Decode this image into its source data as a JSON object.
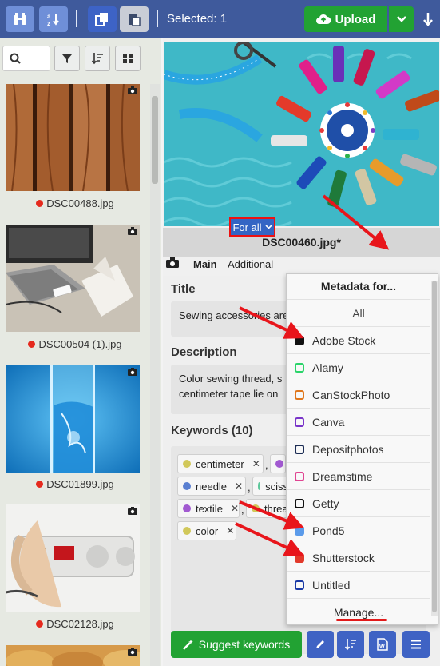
{
  "toolbar": {
    "selected_label": "Selected: 1",
    "upload_label": "Upload"
  },
  "left_panel": {
    "search_placeholder": "",
    "thumbnails": [
      {
        "file": "DSC00488.jpg",
        "status_color": "#e52a1e"
      },
      {
        "file": "DSC00504 (1).jpg",
        "status_color": "#e52a1e"
      },
      {
        "file": "DSC01899.jpg",
        "status_color": "#e52a1e"
      },
      {
        "file": "DSC02128.jpg",
        "status_color": "#e52a1e"
      }
    ]
  },
  "preview": {
    "caption": "DSC00460.jpg*"
  },
  "tabs": {
    "main": "Main",
    "additional": "Additional",
    "for_all": "For all"
  },
  "form": {
    "title_label": "Title",
    "title_value": "Sewing accessories are",
    "description_label": "Description",
    "description_value_line1": "Color sewing thread, s",
    "description_value_line2": "centimeter tape lie on",
    "keywords_label": "Keywords (10)",
    "keywords": [
      {
        "text": "centimeter",
        "color": "#d1c85a"
      },
      {
        "text": "needle",
        "color": "#5a7fd1"
      },
      {
        "text": "sciss",
        "color": "#5cc79a"
      },
      {
        "text": "textile",
        "color": "#a25ad1"
      },
      {
        "text": "threa",
        "color": "#d1c85a"
      },
      {
        "text": "color",
        "color": "#d1c85a"
      }
    ],
    "suggest_label": "Suggest keywords"
  },
  "dropdown": {
    "title": "Metadata for...",
    "all_label": "All",
    "items": [
      {
        "label": "Adobe Stock",
        "color": "#111111",
        "filled": true
      },
      {
        "label": "Alamy",
        "color": "#2bd46a",
        "filled": false
      },
      {
        "label": "CanStockPhoto",
        "color": "#e0771c",
        "filled": false
      },
      {
        "label": "Canva",
        "color": "#7a35c9",
        "filled": false
      },
      {
        "label": "Depositphotos",
        "color": "#1d2e55",
        "filled": false
      },
      {
        "label": "Dreamstime",
        "color": "#e04592",
        "filled": false
      },
      {
        "label": "Getty",
        "color": "#111111",
        "filled": false
      },
      {
        "label": "Pond5",
        "color": "#5b9bea",
        "filled": true
      },
      {
        "label": "Shutterstock",
        "color": "#e2392a",
        "filled": true
      },
      {
        "label": "Untitled",
        "color": "#1a3aa6",
        "filled": false
      }
    ],
    "manage_label": "Manage..."
  }
}
